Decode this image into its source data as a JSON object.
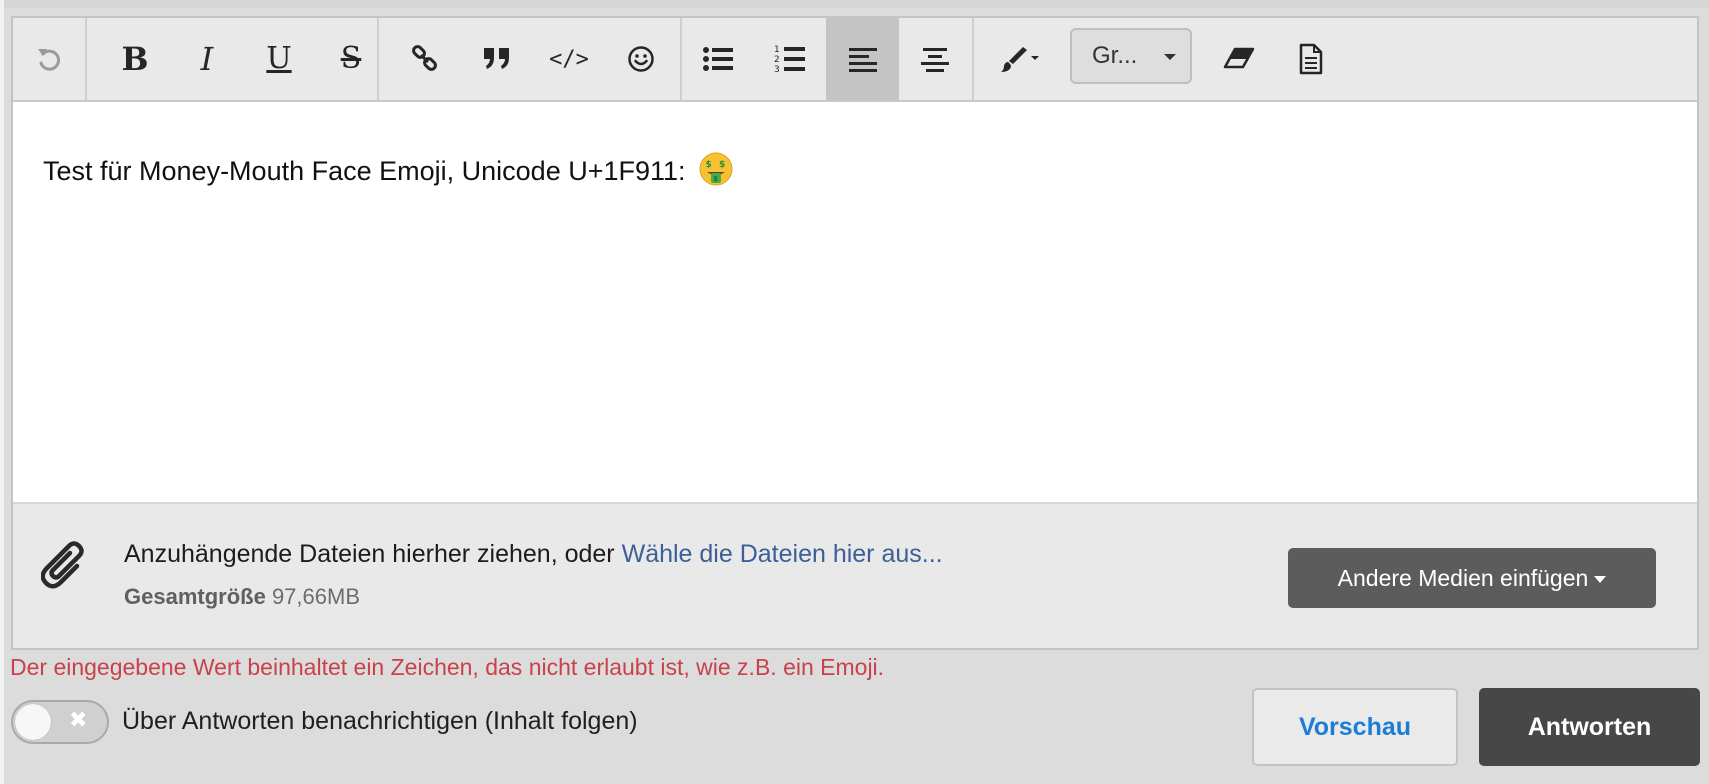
{
  "toolbar": {
    "buttons": [
      {
        "name": "undo-icon",
        "glyph": "undo"
      },
      {
        "name": "bold-icon",
        "glyph": "B"
      },
      {
        "name": "italic-icon",
        "glyph": "I"
      },
      {
        "name": "underline-icon",
        "glyph": "U"
      },
      {
        "name": "strikethrough-icon",
        "glyph": "S"
      },
      {
        "name": "link-icon",
        "glyph": "link"
      },
      {
        "name": "quote-icon",
        "glyph": "quote"
      },
      {
        "name": "code-icon",
        "glyph": "code"
      },
      {
        "name": "emoji-icon",
        "glyph": "smiley"
      },
      {
        "name": "bullet-list-icon",
        "glyph": "bullets"
      },
      {
        "name": "numbered-list-icon",
        "glyph": "numbers"
      },
      {
        "name": "align-left-icon",
        "glyph": "align-left",
        "active": true
      },
      {
        "name": "align-center-icon",
        "glyph": "align-center"
      },
      {
        "name": "brush-icon",
        "glyph": "brush"
      },
      {
        "name": "eraser-icon",
        "glyph": "eraser"
      },
      {
        "name": "source-document-icon",
        "glyph": "document"
      }
    ],
    "bold_label": "B",
    "italic_label": "I",
    "underline_label": "U",
    "strike_label": "S",
    "code_label": "</>",
    "font_select_value": "Gr...",
    "colors": {
      "toolbar_bg": "#e9e9e9",
      "active_bg": "#c4c4c4"
    }
  },
  "editor": {
    "content_text": "Test für Money-Mouth Face Emoji, Unicode U+1F911:",
    "emoji": "money-mouth-face-emoji"
  },
  "attachments": {
    "drop_text": "Anzuhängende Dateien hierher ziehen, oder ",
    "choose_link": "Wähle die Dateien hier aus...",
    "total_label": "Gesamtgröße",
    "total_value": " 97,66MB",
    "media_button_label": "Andere Medien einfügen"
  },
  "error": {
    "message": "Der eingegebene Wert beinhaltet ein Zeichen, das nicht erlaubt ist, wie z.B. ein Emoji.",
    "color": "#c9414a"
  },
  "notify_toggle": {
    "label": "Über Antworten benachrichtigen (Inhalt folgen)",
    "state": "off",
    "off_symbol": "✖"
  },
  "actions": {
    "preview_label": "Vorschau",
    "reply_label": "Antworten",
    "preview_color": "#1b7dd6",
    "reply_bg": "#474747"
  }
}
